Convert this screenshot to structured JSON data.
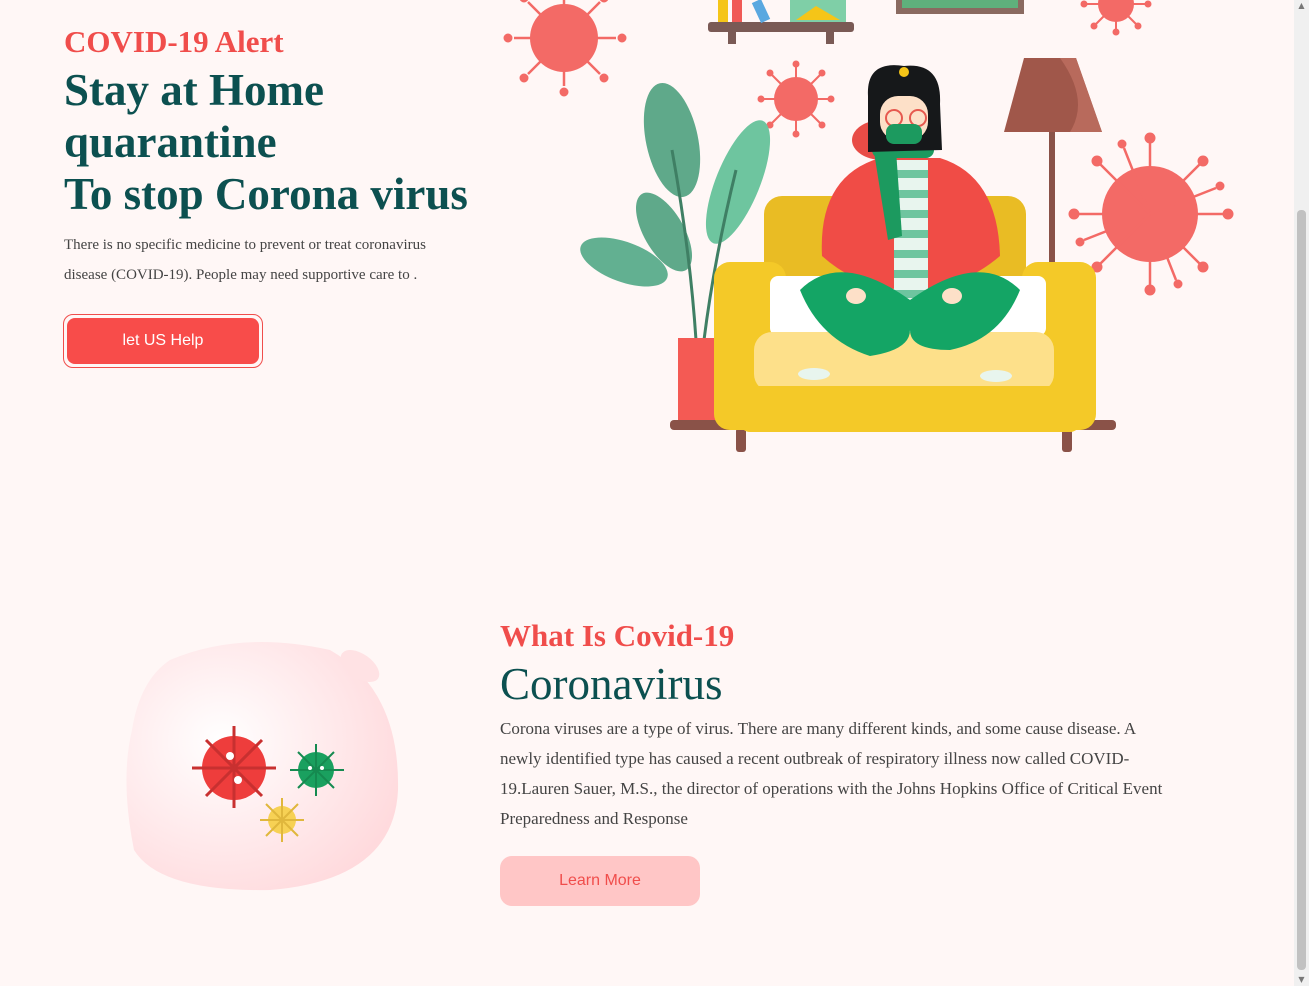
{
  "hero": {
    "kicker": "COVID-19 Alert",
    "title_lines": [
      "Stay at Home",
      "quarantine",
      "To stop Corona virus"
    ],
    "description": "There is no specific medicine to prevent or treat coronavirus disease (COVID-19). People may need supportive care to .",
    "button_label": "let US Help",
    "illustration_icon": "woman-on-sofa-quarantine-icon"
  },
  "about": {
    "kicker": "What Is Covid-19",
    "title": "Coronavirus",
    "description": "Corona viruses are a type of virus. There are many different kinds, and some cause disease. A newly identified type has caused a recent outbreak of respiratory illness now called COVID-19.Lauren Sauer, M.S., the director of operations with the Johns Hopkins Office of Critical Event Preparedness and Response",
    "button_label": "Learn More",
    "illustration_icon": "virus-cells-blob-icon"
  },
  "colors": {
    "accent_red": "#f04d4b",
    "title_teal": "#0c5050",
    "background": "#fff7f6",
    "learn_button_bg": "#ffc6c6"
  }
}
